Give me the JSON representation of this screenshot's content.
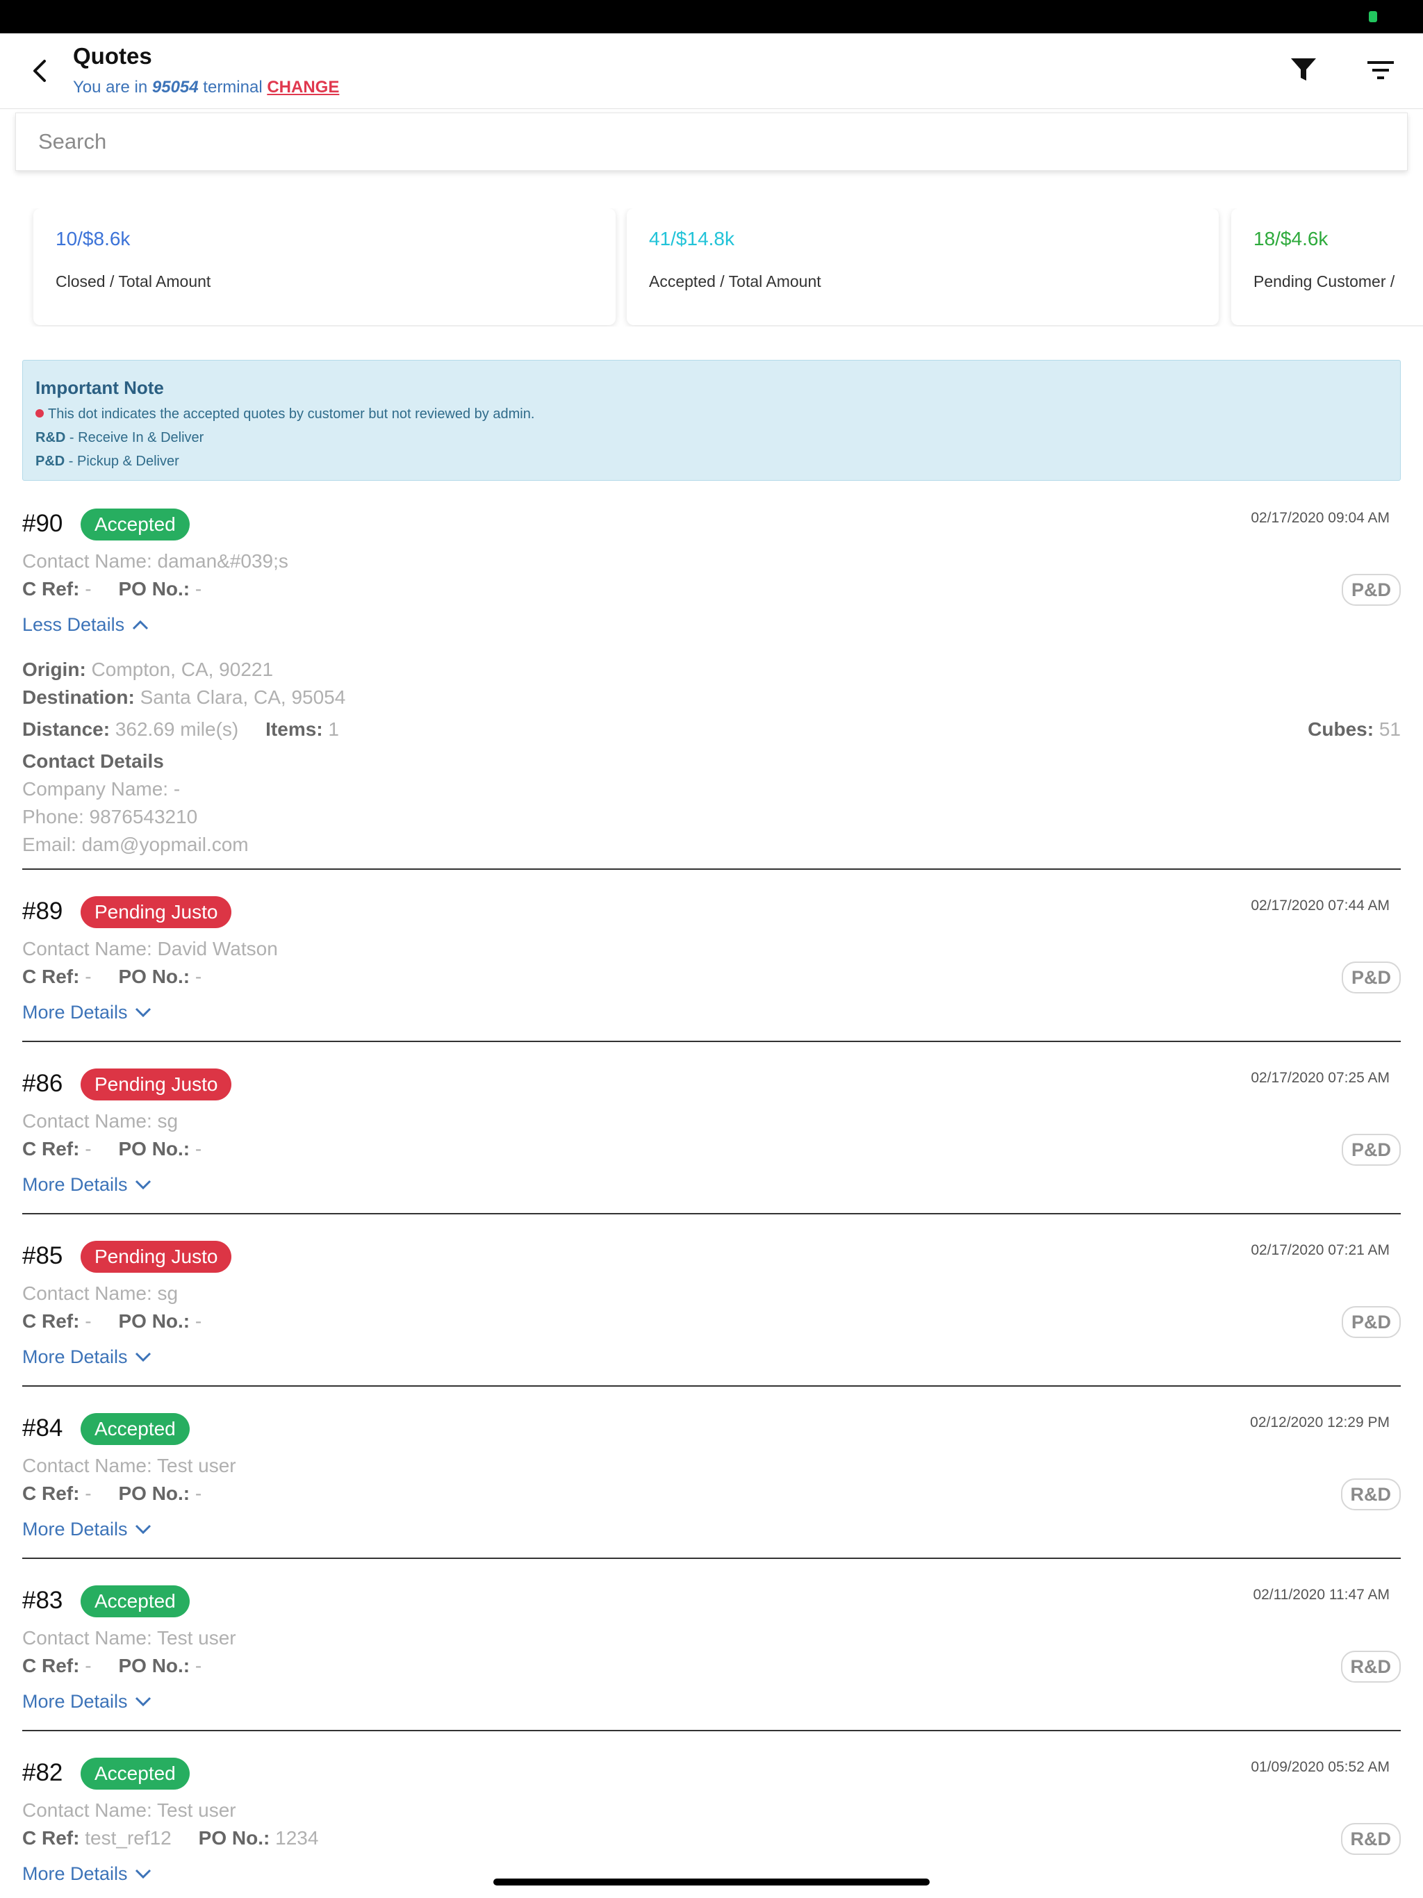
{
  "header": {
    "title": "Quotes",
    "subtitle_prefix": "You are in",
    "terminal": "95054",
    "subtitle_mid": "terminal",
    "change_label": "CHANGE",
    "icons": [
      "back-icon",
      "filter-icon",
      "sort-icon"
    ]
  },
  "search": {
    "placeholder": "Search"
  },
  "summary": [
    {
      "value": "10/$8.6k",
      "label": "Closed / Total Amount",
      "color": "#3c73d8"
    },
    {
      "value": "41/$14.8k",
      "label": "Accepted / Total Amount",
      "color": "#22c3d8"
    },
    {
      "value": "18/$4.6k",
      "label": "Pending Customer /",
      "color": "#2eaa3c"
    }
  ],
  "note": {
    "title": "Important Note",
    "dot_text": "This dot indicates the accepted quotes by customer but not reviewed by admin.",
    "rd_code": "R&D",
    "rd_text": "- Receive In & Deliver",
    "pd_code": "P&D",
    "pd_text": "- Pickup & Deliver"
  },
  "labels": {
    "cref": "C Ref:",
    "po": "PO No.:",
    "less": "Less Details",
    "more": "More Details",
    "origin": "Origin:",
    "destination": "Destination:",
    "distance": "Distance:",
    "items": "Items:",
    "cubes": "Cubes:",
    "contact_details": "Contact Details"
  },
  "quotes": [
    {
      "id": "#90",
      "status": "Accepted",
      "status_color": "#27ae60",
      "date": "02/17/2020 09:04 AM",
      "contact": "Contact Name: daman&#039;s",
      "cref": "-",
      "po": "-",
      "tag": "P&D"
    },
    {
      "id": "#89",
      "status": "Pending Justo",
      "status_color": "#dc3545",
      "date": "02/17/2020 07:44 AM",
      "contact": "Contact Name: David Watson",
      "cref": "-",
      "po": "-",
      "tag": "P&D"
    },
    {
      "id": "#86",
      "status": "Pending Justo",
      "status_color": "#dc3545",
      "date": "02/17/2020 07:25 AM",
      "contact": "Contact Name: sg",
      "cref": "-",
      "po": "-",
      "tag": "P&D"
    },
    {
      "id": "#85",
      "status": "Pending Justo",
      "status_color": "#dc3545",
      "date": "02/17/2020 07:21 AM",
      "contact": "Contact Name: sg",
      "cref": "-",
      "po": "-",
      "tag": "P&D"
    },
    {
      "id": "#84",
      "status": "Accepted",
      "status_color": "#27ae60",
      "date": "02/12/2020 12:29 PM",
      "contact": "Contact Name: Test user",
      "cref": "-",
      "po": "-",
      "tag": "R&D"
    },
    {
      "id": "#83",
      "status": "Accepted",
      "status_color": "#27ae60",
      "date": "02/11/2020 11:47 AM",
      "contact": "Contact Name: Test user",
      "cref": "-",
      "po": "-",
      "tag": "R&D"
    },
    {
      "id": "#82",
      "status": "Accepted",
      "status_color": "#27ae60",
      "date": "01/09/2020 05:52 AM",
      "contact": "Contact Name: Test user",
      "cref": "test_ref12",
      "po": "1234",
      "tag": "R&D"
    }
  ],
  "expanded": {
    "origin": "Compton, CA, 90221",
    "destination": "Santa Clara, CA, 95054",
    "distance": "362.69 mile(s)",
    "items": "1",
    "cubes": "51",
    "company": "Company Name: -",
    "phone": "Phone: 9876543210",
    "email": "Email: dam@yopmail.com"
  }
}
